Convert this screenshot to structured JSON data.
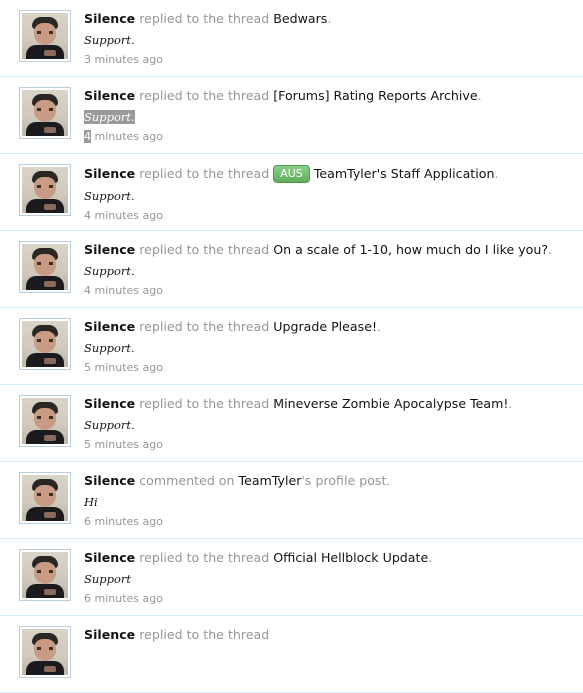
{
  "feed": [
    {
      "user": "Silence",
      "action": "replied to the thread",
      "thread": "Bedwars",
      "snippet": "Support.",
      "time": "3 minutes ago"
    },
    {
      "user": "Silence",
      "action": "replied to the thread",
      "thread": "[Forums] Rating Reports Archive",
      "snippet": "Support.",
      "time_digit": "4",
      "time_rest": " minutes ago"
    },
    {
      "user": "Silence",
      "action": "replied to the thread",
      "prefix": "AUS",
      "thread": "TeamTyler's Staff Application",
      "snippet": "Support.",
      "time": "4 minutes ago"
    },
    {
      "user": "Silence",
      "action": "replied to the thread",
      "thread": "On a scale of 1-10, how much do I like you?",
      "snippet": "Support.",
      "time": "4 minutes ago"
    },
    {
      "user": "Silence",
      "action": "replied to the thread",
      "thread": "Upgrade Please!",
      "snippet": "Support.",
      "time": "5 minutes ago"
    },
    {
      "user": "Silence",
      "action": "replied to the thread",
      "thread": "Mineverse Zombie Apocalypse Team!",
      "snippet": "Support.",
      "time": "5 minutes ago"
    },
    {
      "user": "Silence",
      "action": "commented on",
      "profile_user": "TeamTyler",
      "profile_suffix": "'s profile post.",
      "snippet": "Hi",
      "time": "6 minutes ago"
    },
    {
      "user": "Silence",
      "action": "replied to the thread",
      "thread": "Official Hellblock Update",
      "snippet": "Support",
      "time": "6 minutes ago"
    },
    {
      "user": "Silence",
      "action": "replied to the thread"
    }
  ],
  "punctuation": "."
}
